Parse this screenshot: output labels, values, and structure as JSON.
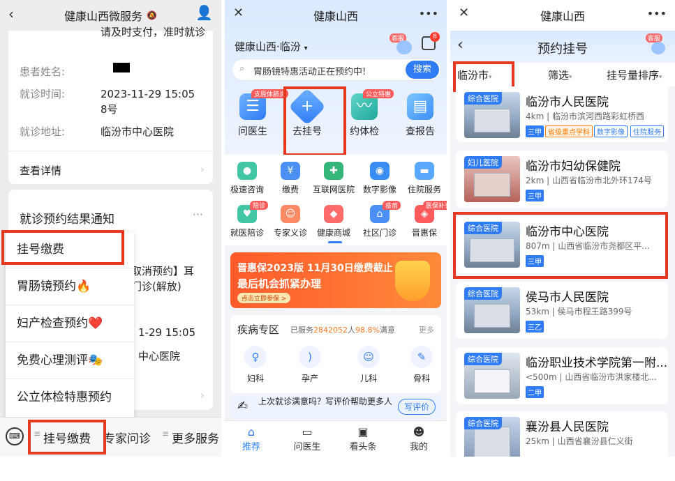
{
  "panel1": {
    "title": "健康山西微服务",
    "top_text": "请及时支付，准时就诊",
    "fields": [
      {
        "label": "患者姓名:",
        "value": ""
      },
      {
        "label": "就诊时间:",
        "value": "2023-11-29 15:05\n8号"
      },
      {
        "label": "就诊地址:",
        "value": "临汾市中心医院"
      }
    ],
    "detail_link": "查看详情",
    "notice_title": "就诊预约结果通知",
    "hidden_text_1": "取消预约】耳",
    "hidden_text_2": "门诊(解放)",
    "hidden_text_3": "1-29 15:05",
    "hidden_text_4": "中心医院",
    "menu_items": [
      "挂号缴费",
      "胃肠镜预约🔥",
      "妇产检查预约❤️",
      "免费心理测评🎭",
      "公立体检特惠预约"
    ],
    "bottom_menus": [
      "挂号缴费",
      "专家问诊",
      "更多服务"
    ]
  },
  "panel2": {
    "title": "健康山西",
    "location": "健康山西·临汾",
    "service_badge": "客服",
    "msg_count": "8",
    "search_placeholder": "胃肠镜特惠活动正在预约中!",
    "search_button": "搜索",
    "big_items": [
      {
        "label": "问医生",
        "tag": "支原体肺炎"
      },
      {
        "label": "去挂号",
        "tag": ""
      },
      {
        "label": "约体检",
        "tag": "公立特惠"
      },
      {
        "label": "查报告",
        "tag": ""
      }
    ],
    "grid_items": [
      {
        "label": "极速咨询",
        "tag": ""
      },
      {
        "label": "缴费",
        "tag": ""
      },
      {
        "label": "互联网医院",
        "tag": ""
      },
      {
        "label": "数字影像",
        "tag": ""
      },
      {
        "label": "住院服务",
        "tag": ""
      },
      {
        "label": "就医陪诊",
        "tag": "陪诊"
      },
      {
        "label": "专家义诊",
        "tag": ""
      },
      {
        "label": "健康商城",
        "tag": ""
      },
      {
        "label": "社区门诊",
        "tag": "疫苗"
      },
      {
        "label": "晋惠保",
        "tag": "医保补充"
      }
    ],
    "banner": {
      "line1": "晋惠保2023版 11月30日缴费截止",
      "line2": "最后机会抓紧办理",
      "cta": "点击立即参保 >"
    },
    "disease": {
      "title": "疾病专区",
      "stats_prefix": "已服务",
      "stats_count": "2842052",
      "stats_mid": "人",
      "stats_rate": "98.8%",
      "stats_suffix": "满意",
      "more": "更多",
      "items": [
        "妇科",
        "孕产",
        "儿科",
        "骨科"
      ]
    },
    "feedback": {
      "text": "上次就诊满意吗？写评价帮助更多人",
      "button": "写评价"
    },
    "tabs": [
      "推荐",
      "问医生",
      "看头条",
      "我的"
    ]
  },
  "panel3": {
    "title": "健康山西",
    "subtitle": "预约挂号",
    "service_badge": "客服",
    "filters": [
      "临汾市",
      "筛选",
      "挂号量排序"
    ],
    "hospitals": [
      {
        "type": "综合医院",
        "name": "临汾市人民医院",
        "distance": "4km | 临汾市滨河西路彩虹桥西",
        "level": "三甲",
        "tags": [
          "省级重点学科",
          "数字影像",
          "住院服务"
        ]
      },
      {
        "type": "妇儿医院",
        "name": "临汾市妇幼保健院",
        "distance": "2km | 山西省临汾市北外环174号",
        "level": "三甲",
        "tags": []
      },
      {
        "type": "综合医院",
        "name": "临汾市中心医院",
        "distance": "807m | 山西省临汾市尧都区平...",
        "level": "三甲",
        "tags": []
      },
      {
        "type": "综合医院",
        "name": "侯马市人民医院",
        "distance": "53km | 侯马市程王路399号",
        "level": "三乙",
        "tags": []
      },
      {
        "type": "综合医院",
        "name": "临汾职业技术学院第一附...",
        "distance": "<500m | 山西省临汾市洪家楼北...",
        "level": "二甲",
        "tags": []
      },
      {
        "type": "综合医院",
        "name": "襄汾县人民医院",
        "distance": "25km | 山西省襄汾县仁义街",
        "level": "",
        "tags": []
      }
    ]
  },
  "colors": {
    "accent": "#2f7cf6",
    "highlight": "#e5391f",
    "orange": "#ff6a2b"
  }
}
